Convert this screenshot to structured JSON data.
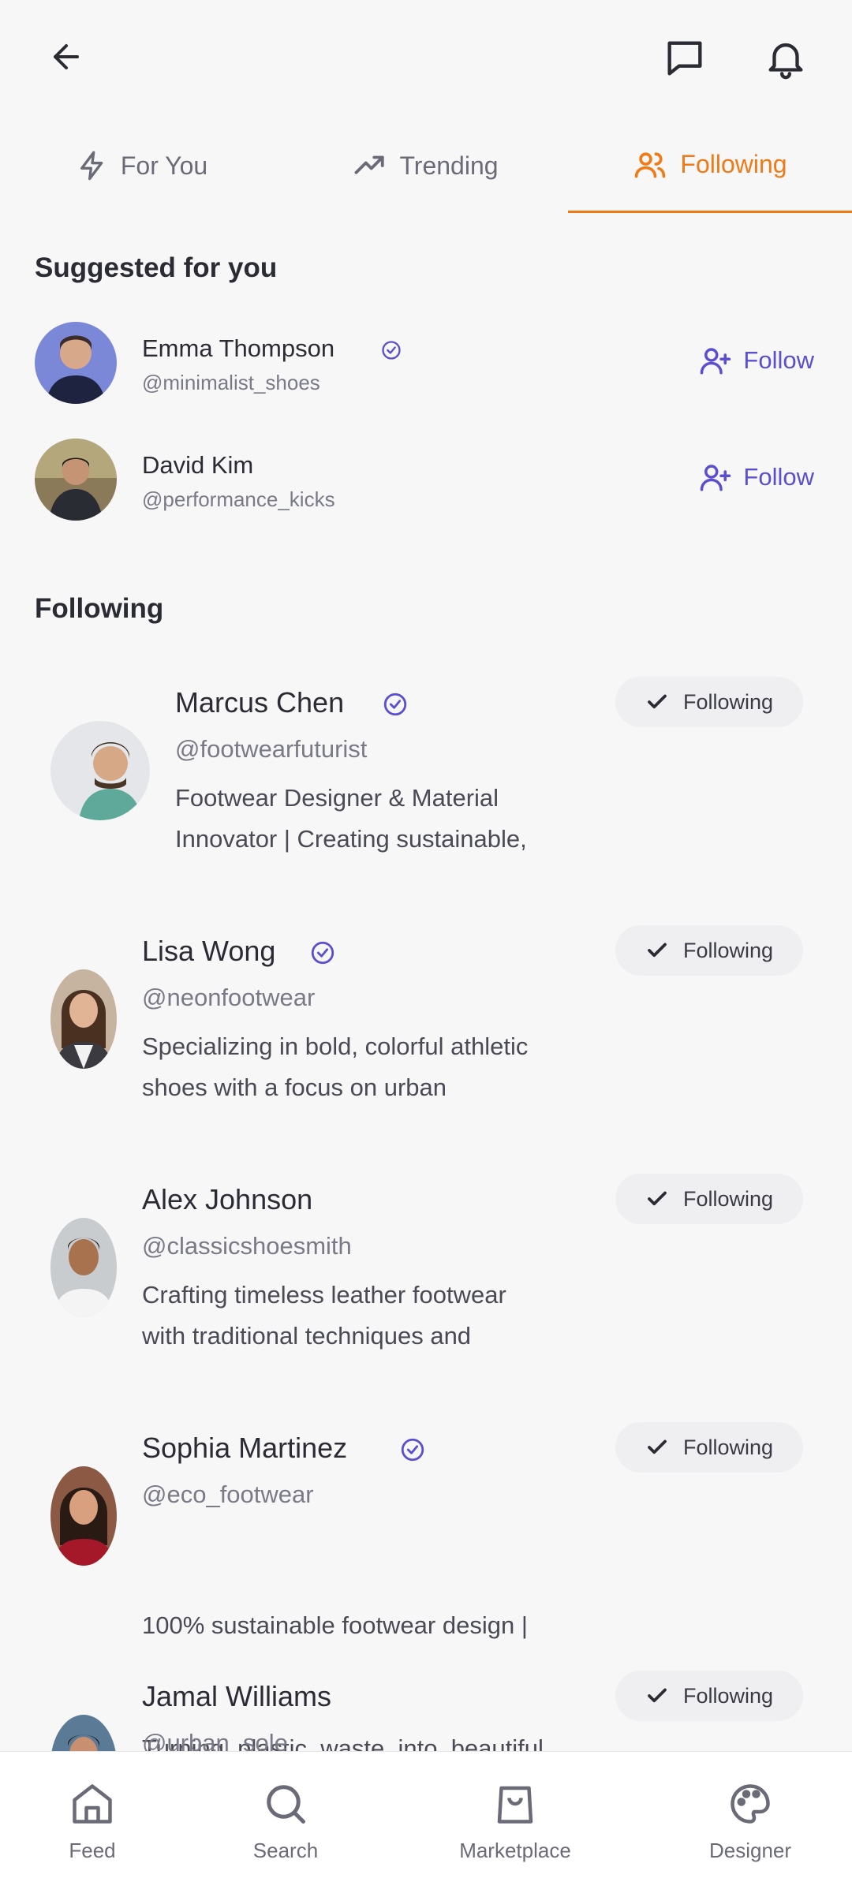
{
  "header": {
    "back_icon": "arrow-left-icon",
    "messages_icon": "chat-bubble-icon",
    "notifications_icon": "bell-icon"
  },
  "tabs": [
    {
      "label": "For You",
      "icon": "lightning-icon",
      "active": false
    },
    {
      "label": "Trending",
      "icon": "trending-up-icon",
      "active": false
    },
    {
      "label": "Following",
      "icon": "users-icon",
      "active": true
    }
  ],
  "suggested": {
    "title": "Suggested for you",
    "users": [
      {
        "name": "Emma Thompson",
        "handle": "@minimalist_shoes",
        "verified": true,
        "follow_label": "Follow"
      },
      {
        "name": "David Kim",
        "handle": "@performance_kicks",
        "verified": false,
        "follow_label": "Follow"
      }
    ]
  },
  "following": {
    "title": "Following",
    "users": [
      {
        "name": "Marcus Chen",
        "handle": "@footwearfuturist",
        "verified": true,
        "bio_line1": "Footwear Designer & Material",
        "bio_line2": "Innovator | Creating sustainable,",
        "status_label": "Following"
      },
      {
        "name": "Lisa Wong",
        "handle": "@neonfootwear",
        "verified": true,
        "bio_line1": "Specializing in bold, colorful athletic",
        "bio_line2": "shoes with a focus on urban",
        "status_label": "Following"
      },
      {
        "name": "Alex Johnson",
        "handle": "@classicshoesmith",
        "verified": false,
        "bio_line1": "Crafting timeless leather footwear",
        "bio_line2": "with traditional techniques and",
        "status_label": "Following"
      },
      {
        "name": "Sophia Martinez",
        "handle": "@eco_footwear",
        "verified": true,
        "bio_line1": "100% sustainable footwear design |",
        "bio_line2": "Turning  plastic  waste  into  beautiful,",
        "status_label": "Following"
      },
      {
        "name": "Jamal Williams",
        "handle": "@urban_sole",
        "verified": false,
        "bio_line1": "",
        "bio_line2": "",
        "status_label": "Following"
      }
    ]
  },
  "bottom_nav": [
    {
      "label": "Feed",
      "icon": "home-icon"
    },
    {
      "label": "Search",
      "icon": "search-icon"
    },
    {
      "label": "Marketplace",
      "icon": "shopping-bag-icon"
    },
    {
      "label": "Designer",
      "icon": "palette-icon"
    }
  ],
  "colors": {
    "accent_orange": "#f07a16",
    "accent_purple": "#5a4fd0",
    "background": "#f7f7f8"
  }
}
